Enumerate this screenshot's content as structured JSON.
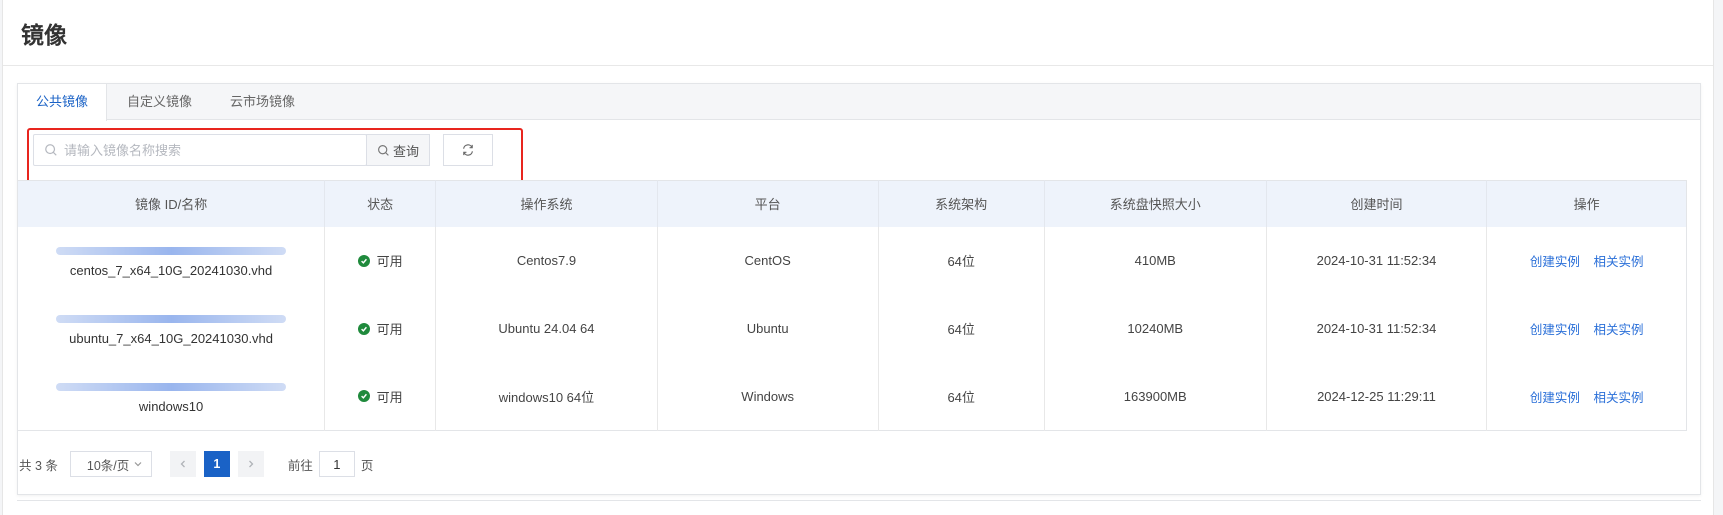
{
  "header": {
    "title": "镜像"
  },
  "tabs": [
    {
      "label": "公共镜像",
      "active": true
    },
    {
      "label": "自定义镜像",
      "active": false
    },
    {
      "label": "云市场镜像",
      "active": false
    }
  ],
  "search": {
    "placeholder": "请输入镜像名称搜索",
    "value": "",
    "query_label": "查询"
  },
  "table": {
    "columns": [
      "镜像 ID/名称",
      "状态",
      "操作系统",
      "平台",
      "系统架构",
      "系统盘快照大小",
      "创建时间",
      "操作"
    ],
    "rows": [
      {
        "name": "centos_7_x64_10G_20241030.vhd",
        "status": "可用",
        "os": "Centos7.9",
        "platform": "CentOS",
        "arch": "64位",
        "size": "410MB",
        "created": "2024-10-31 11:52:34",
        "action_create": "创建实例",
        "action_related": "相关实例"
      },
      {
        "name": "ubuntu_7_x64_10G_20241030.vhd",
        "status": "可用",
        "os": "Ubuntu 24.04 64",
        "platform": "Ubuntu",
        "arch": "64位",
        "size": "10240MB",
        "created": "2024-10-31 11:52:34",
        "action_create": "创建实例",
        "action_related": "相关实例"
      },
      {
        "name": "windows10",
        "status": "可用",
        "os": "windows10 64位",
        "platform": "Windows",
        "arch": "64位",
        "size": "163900MB",
        "created": "2024-12-25 11:29:11",
        "action_create": "创建实例",
        "action_related": "相关实例"
      }
    ]
  },
  "pagination": {
    "total": "共 3 条",
    "page_size": "10条/页",
    "current_page": "1",
    "goto_label": "前往",
    "goto_value": "1",
    "goto_suffix": "页"
  },
  "colors": {
    "accent": "#1a62c6",
    "status_ok": "#1f8a3c",
    "highlight_border": "#e8251e"
  }
}
